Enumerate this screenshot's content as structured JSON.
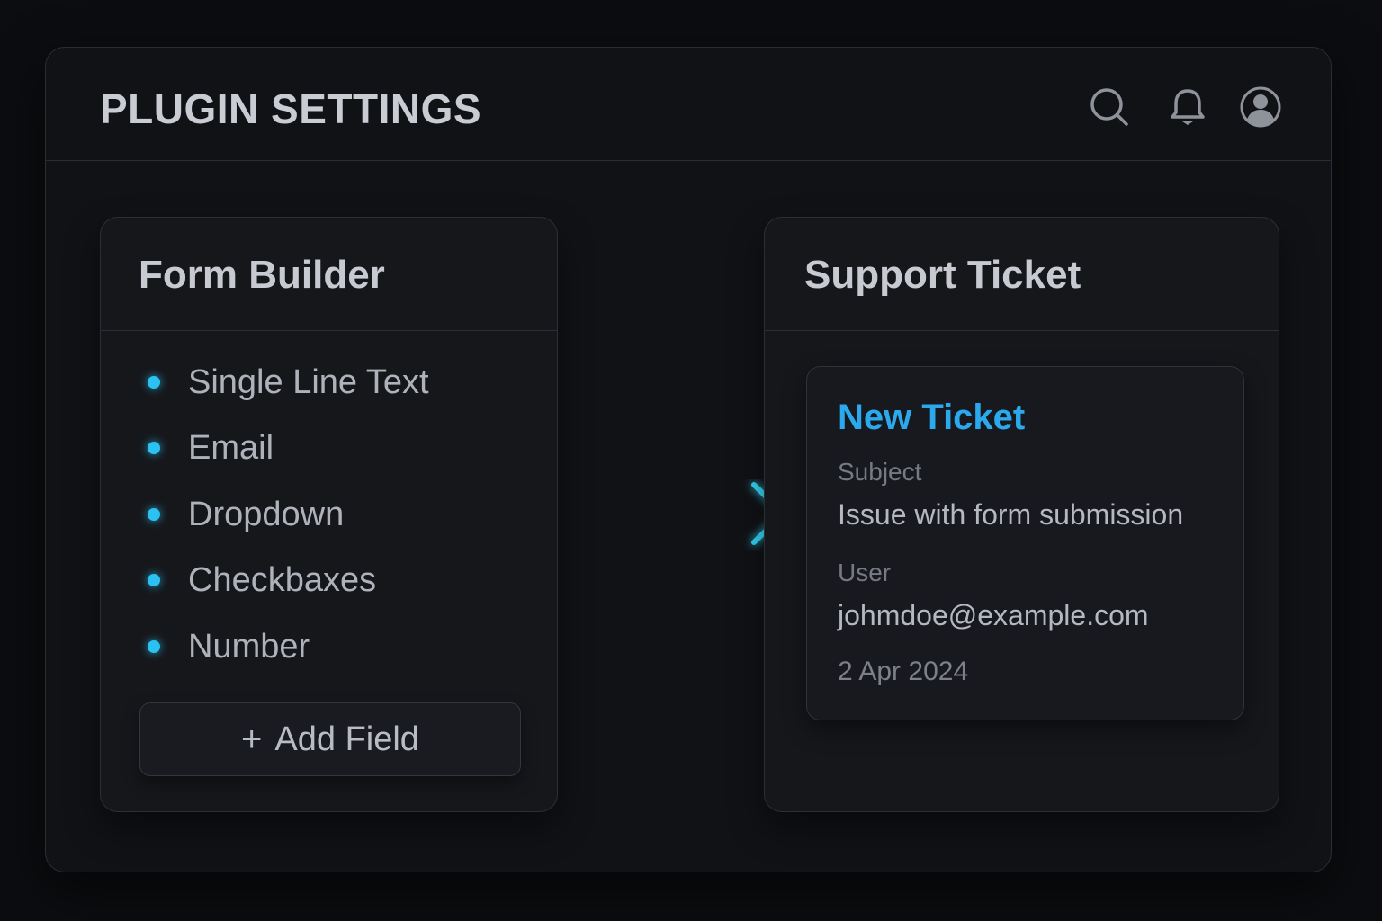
{
  "header": {
    "title": "PLUGIN SETTINGS",
    "icons": [
      "search-icon",
      "bell-icon",
      "user-avatar-icon"
    ]
  },
  "form_builder": {
    "title": "Form Builder",
    "fields": [
      {
        "label": "Single Line Text"
      },
      {
        "label": "Email"
      },
      {
        "label": "Dropdown"
      },
      {
        "label": "Checkbaxes"
      },
      {
        "label": "Number"
      }
    ],
    "add_button": {
      "icon": "plus",
      "plus_symbol": "+",
      "label": "Add Field"
    }
  },
  "support_ticket": {
    "title": "Support Ticket",
    "card": {
      "title": "New Ticket",
      "subject_label": "Subject",
      "subject_value": "Issue with form submission",
      "user_label": "User",
      "user_value": "johmdoe@example.com",
      "date": "2 Apr 2024"
    }
  },
  "colors": {
    "background": "#0c0d10",
    "panel": "#16171b",
    "accent": "#2aa9ec",
    "bullet": "#2bc2f2",
    "text_primary": "#c7cad1",
    "text_muted": "#757a84"
  }
}
